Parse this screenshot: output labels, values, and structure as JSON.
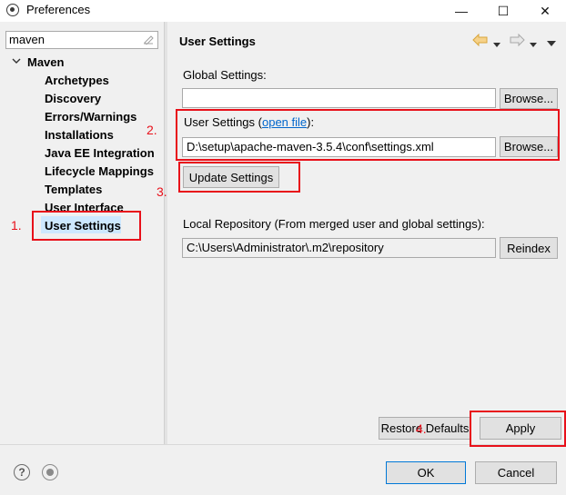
{
  "window": {
    "title": "Preferences",
    "minimize_glyph": "—",
    "maximize_glyph": "☐",
    "close_glyph": "✕"
  },
  "filter": {
    "value": "maven"
  },
  "tree": {
    "root": "Maven",
    "children": [
      "Archetypes",
      "Discovery",
      "Errors/Warnings",
      "Installations",
      "Java EE Integration",
      "Lifecycle Mappings",
      "Templates",
      "User Interface",
      "User Settings"
    ],
    "selected": "User Settings"
  },
  "page": {
    "title": "User Settings",
    "global_settings_label": "Global Settings:",
    "global_settings_value": "",
    "browse_label": "Browse...",
    "user_settings_label_prefix": "User Settings (",
    "user_settings_link": "open file",
    "user_settings_label_suffix": "):",
    "user_settings_value": "D:\\setup\\apache-maven-3.5.4\\conf\\settings.xml",
    "update_settings_label": "Update Settings",
    "local_repo_label": "Local Repository (From merged user and global settings):",
    "local_repo_value": "C:\\Users\\Administrator\\.m2\\repository",
    "reindex_label": "Reindex",
    "restore_defaults_label": "Restore Defaults",
    "apply_label": "Apply"
  },
  "dialog": {
    "ok_label": "OK",
    "cancel_label": "Cancel"
  },
  "annotations": {
    "step1": "1.",
    "step2": "2.",
    "step3": "3.",
    "step4": "4.",
    "color": "#e8101a"
  },
  "colors": {
    "selection": "#cde8ff",
    "link": "#0066cc",
    "nav_arrow": "#d9a53a"
  }
}
